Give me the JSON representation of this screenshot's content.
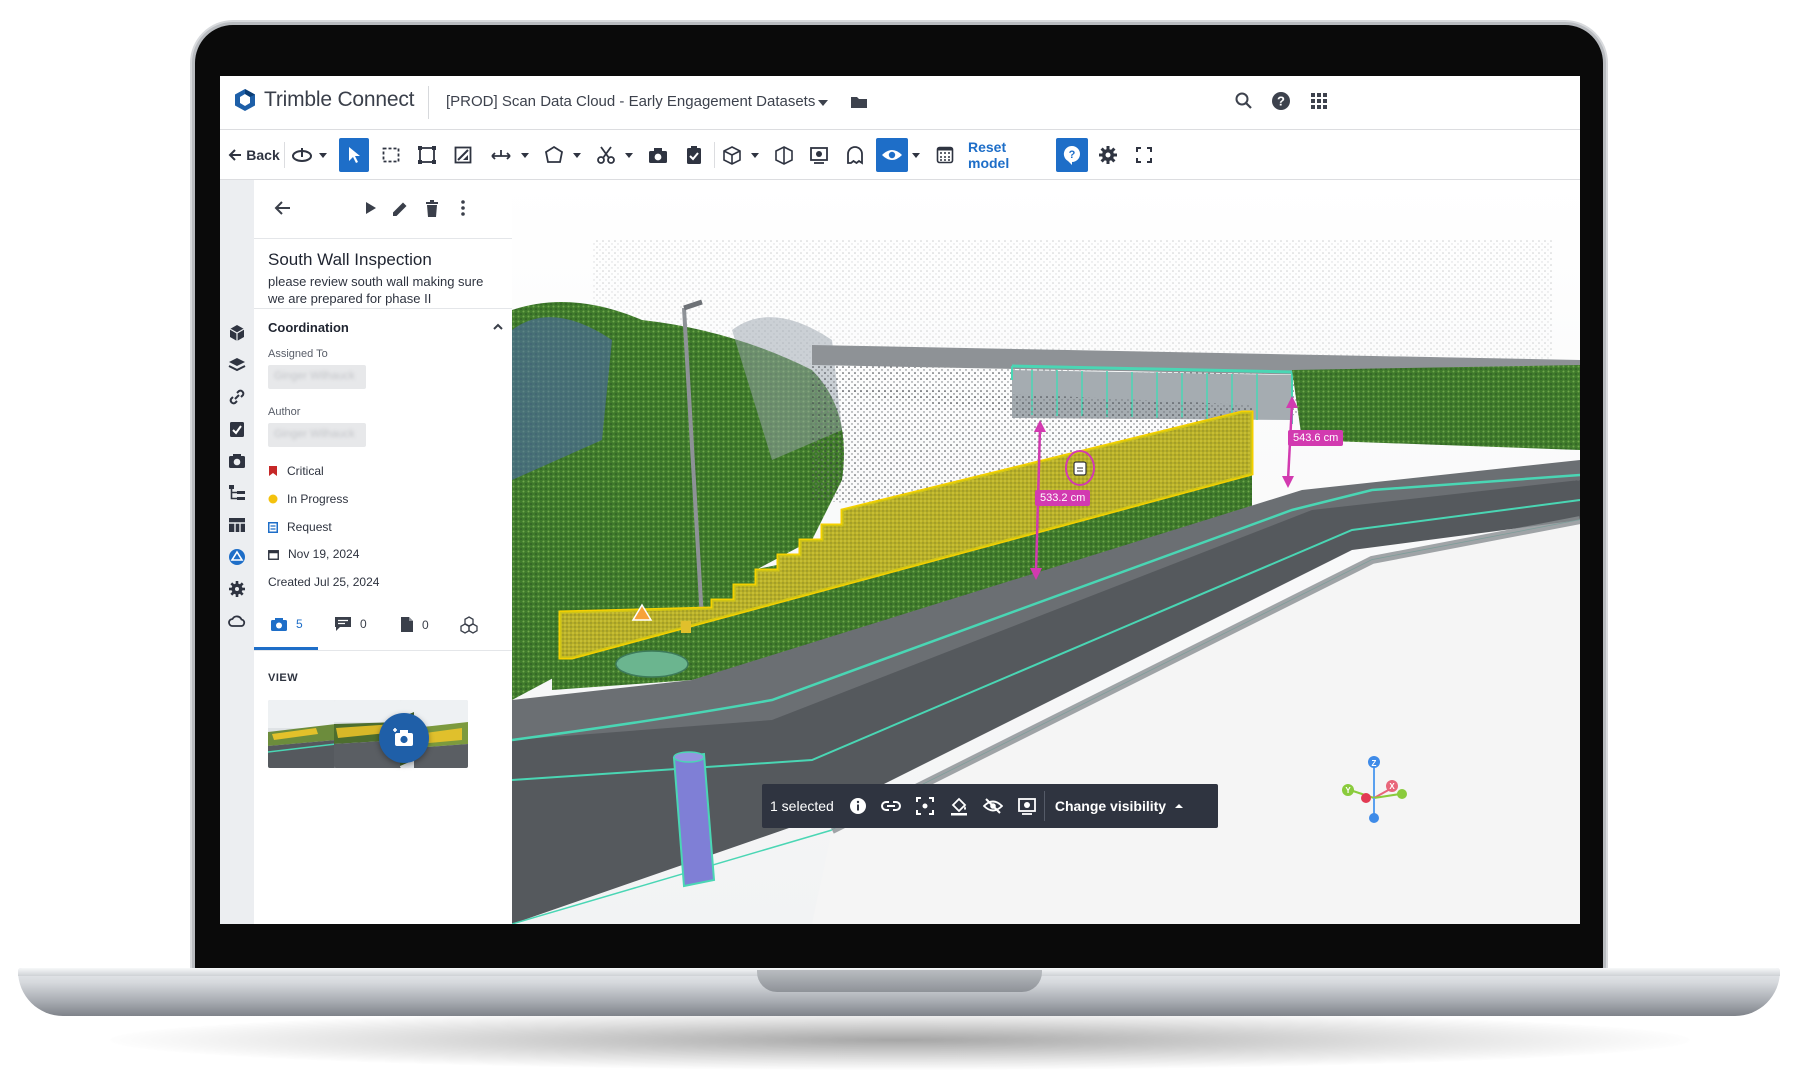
{
  "header": {
    "logo_text": "Trimble Connect",
    "project_name": "[PROD] Scan Data Cloud - Early Engagement Datasets"
  },
  "toolbar": {
    "back_label": "Back",
    "reset_label": "Reset model"
  },
  "rail_icons": [
    "cube-icon",
    "layers-icon",
    "link-icon",
    "checklist-icon",
    "camera-icon",
    "tree-icon",
    "table-icon",
    "issues-icon",
    "settings-icon",
    "cloud-icon"
  ],
  "issue": {
    "title": "South Wall Inspection",
    "description": "please review south wall making sure we are prepared for phase II",
    "section_title": "Coordination",
    "assigned_to_label": "Assigned To",
    "assigned_to_value": "Ginger Wilhauck",
    "author_label": "Author",
    "author_value": "Ginger Wilhauck",
    "priority": "Critical",
    "status": "In Progress",
    "type": "Request",
    "due_date": "Nov 19, 2024",
    "created": "Created Jul 25, 2024",
    "colors": {
      "priority": "#c62828",
      "status": "#f4c20d",
      "accent": "#1e6ec8"
    }
  },
  "tabs": [
    {
      "name": "views",
      "count": "5"
    },
    {
      "name": "comments",
      "count": "0"
    },
    {
      "name": "documents",
      "count": "0"
    },
    {
      "name": "models",
      "count": ""
    }
  ],
  "view_section": {
    "label": "VIEW"
  },
  "measurements": {
    "wall_height": "533.2 cm",
    "right_height": "543.6 cm"
  },
  "selection_bar": {
    "selected_text": "1 selected",
    "visibility_label": "Change visibility"
  },
  "axes": {
    "z": "Z",
    "y": "Y",
    "x": "X"
  }
}
